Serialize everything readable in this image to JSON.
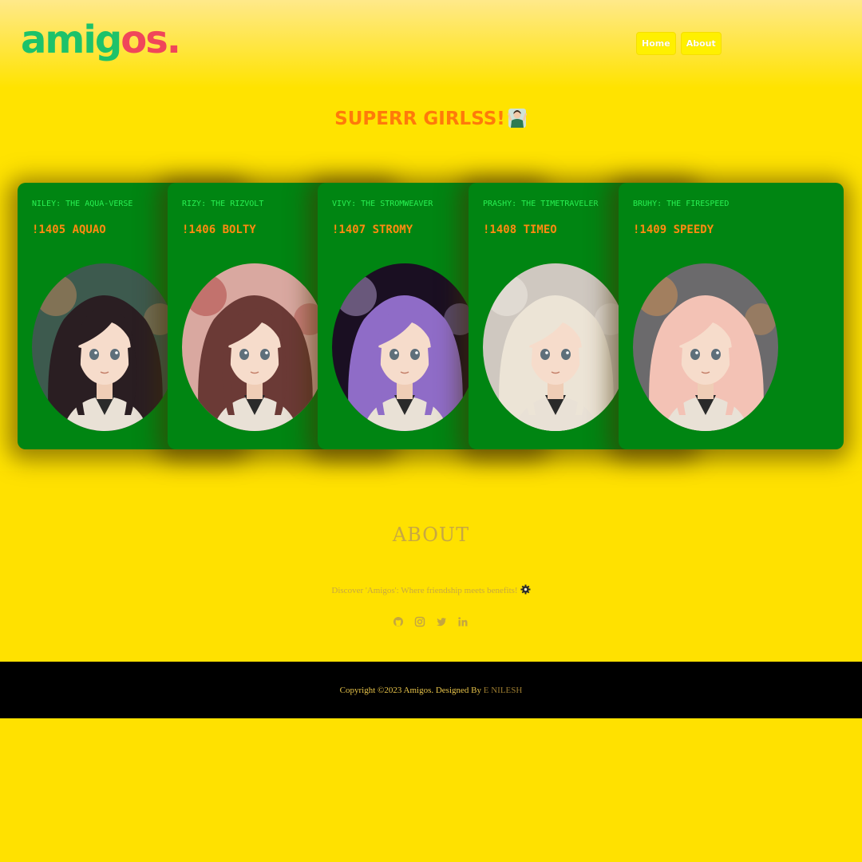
{
  "brand": {
    "logo_part1": "ami",
    "logo_g": "g",
    "logo_part2": "os",
    "logo_dot": "."
  },
  "nav": {
    "home": "Home",
    "about": "About"
  },
  "section": {
    "title": "SUPERR GIRLSS!"
  },
  "cards": [
    {
      "subtitle": "NILEY: THE AQUA-VERSE",
      "name": "!1405 AQUAO",
      "hair": "#2a1e22",
      "bg": "#3d5a4e",
      "accent": "#d59060"
    },
    {
      "subtitle": "RIZY: THE RIZVOLT",
      "name": "!1406 BOLTY",
      "hair": "#6b3a36",
      "bg": "#d9a8a0",
      "accent": "#a7312f"
    },
    {
      "subtitle": "VIVY: THE STROMWEAVER",
      "name": "!1407 STROMY",
      "hair": "#8f6cc7",
      "bg": "#1a0f22",
      "accent": "#c9b2e8"
    },
    {
      "subtitle": "PRASHY: THE TIMETRAVELER",
      "name": "!1408 TIMEO",
      "hair": "#ece4d6",
      "bg": "#cfc8c0",
      "accent": "#f4efe8"
    },
    {
      "subtitle": "BRUHY: THE FIRESPEED",
      "name": "!1409 SPEEDY",
      "hair": "#f3c2b5",
      "bg": "#6b6a6c",
      "accent": "#e79a4f"
    }
  ],
  "about": {
    "title": "ABOUT",
    "text": "Discover 'Amigos': Where friendship meets benefits!"
  },
  "socials": [
    "github-icon",
    "instagram-icon",
    "twitter-icon",
    "linkedin-icon"
  ],
  "footer": {
    "copyright": "Copyright ©2023 Amigos. Designed By",
    "designer": "E NILESH"
  },
  "colors": {
    "page_bg": "#ffe100",
    "card_bg": "#008512",
    "card_subtitle": "#28f052",
    "card_name": "#ff8a10",
    "title": "#ff7a0a",
    "footer_bg": "#000000"
  }
}
